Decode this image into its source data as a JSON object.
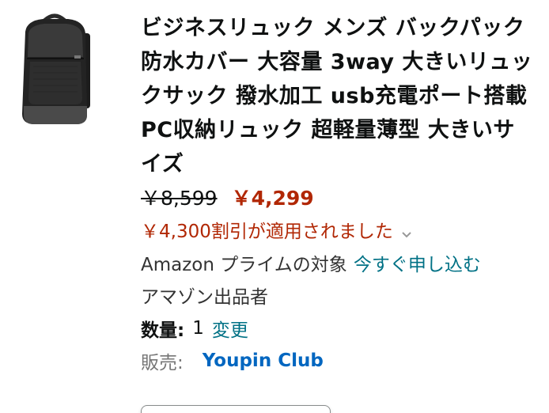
{
  "product": {
    "title": "ビジネスリュック メンズ バックパック 防水カバー 大容量 3way 大きいリュックサック 撥水加工 usb充電ポート搭載 PC収納リュック 超軽量薄型 大きいサイズ",
    "old_price": "￥8,599",
    "new_price": "￥4,299",
    "discount_text": "￥4,300割引が適用されました",
    "prime_text": "Amazon プライムの対象",
    "prime_link": "今すぐ申し込む",
    "seller_type": "アマゾン出品者",
    "quantity_label": "数量:",
    "quantity_value": "1",
    "quantity_change": "変更",
    "sold_by_label": "販売:",
    "sold_by_value": "Youpin Club"
  },
  "icons": {
    "thumbnail": "backpack-image",
    "discount_toggle": "chevron-down-icon"
  },
  "colors": {
    "price_red": "#b12704",
    "link_teal": "#007185",
    "seller_blue": "#0066c0"
  }
}
